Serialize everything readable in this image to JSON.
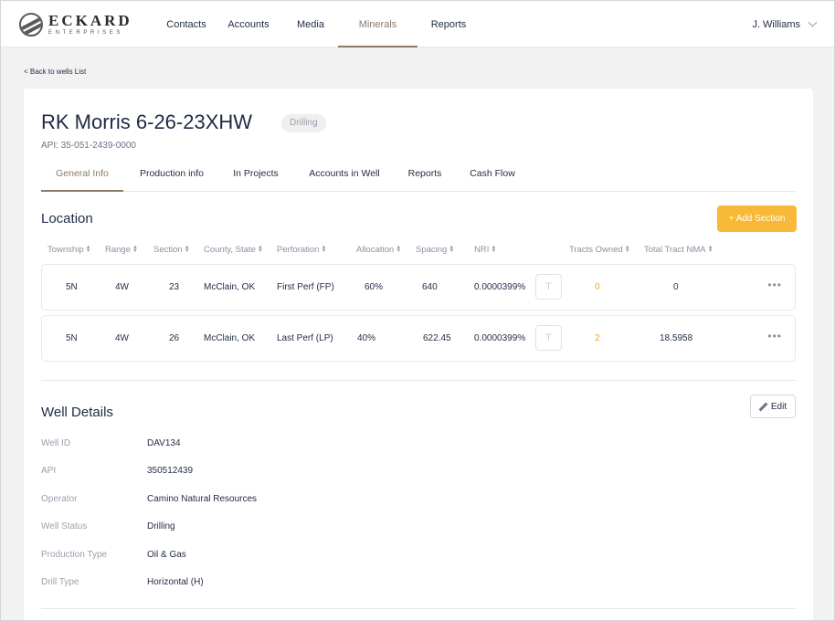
{
  "brand": {
    "name": "ECKARD",
    "sub": "ENTERPRISES"
  },
  "nav": {
    "items": [
      {
        "label": "Contacts"
      },
      {
        "label": "Accounts"
      },
      {
        "label": "Media"
      },
      {
        "label": "Minerals"
      },
      {
        "label": "Reports"
      }
    ],
    "active": "Minerals",
    "user": "J. Williams"
  },
  "back_link": "< Back to wells List",
  "well": {
    "title": "RK Morris 6-26-23XHW",
    "status_badge": "Drilling",
    "api_line": "API: 35-051-2439-0000"
  },
  "tabs": [
    {
      "label": "General Info"
    },
    {
      "label": "Production info"
    },
    {
      "label": "In Projects"
    },
    {
      "label": "Accounts in Well"
    },
    {
      "label": "Reports"
    },
    {
      "label": "Cash Flow"
    }
  ],
  "active_tab": "General Info",
  "location": {
    "title": "Location",
    "add_button": "+ Add Section",
    "headers": [
      "Township",
      "Range",
      "Section",
      "County, State",
      "Perforation",
      "Allocation",
      "Spacing",
      "NRI",
      "Tracts Owned",
      "Total Tract NMA"
    ],
    "t_button": "T",
    "more": "•••",
    "rows": [
      {
        "township": "5N",
        "range": "4W",
        "section": "23",
        "county": "McClain, OK",
        "perforation": "First Perf (FP)",
        "allocation": "60%",
        "spacing": "640",
        "nri": "0.0000399%",
        "tracts_owned": "0",
        "total_nma": "0"
      },
      {
        "township": "5N",
        "range": "4W",
        "section": "26",
        "county": "McClain, OK",
        "perforation": "Last Perf (LP)",
        "allocation": "40%",
        "spacing": "622.45",
        "nri": "0.0000399%",
        "tracts_owned": "2",
        "total_nma": "18.5958"
      }
    ]
  },
  "well_details": {
    "title": "Well Details",
    "edit_button": "Edit",
    "fields": [
      {
        "label": "Well ID",
        "value": "DAV134"
      },
      {
        "label": "API",
        "value": "350512439"
      },
      {
        "label": "Operator",
        "value": "Camino Natural Resources"
      },
      {
        "label": "Well Status",
        "value": "Drilling"
      },
      {
        "label": "Production Type",
        "value": "Oil & Gas"
      },
      {
        "label": "Drill Type",
        "value": "Horizontal (H)"
      }
    ]
  },
  "colors": {
    "accent": "#f8b938",
    "active_tab": "#8a7a6a",
    "text": "#1f2a44",
    "orange_value": "#f5a623"
  }
}
